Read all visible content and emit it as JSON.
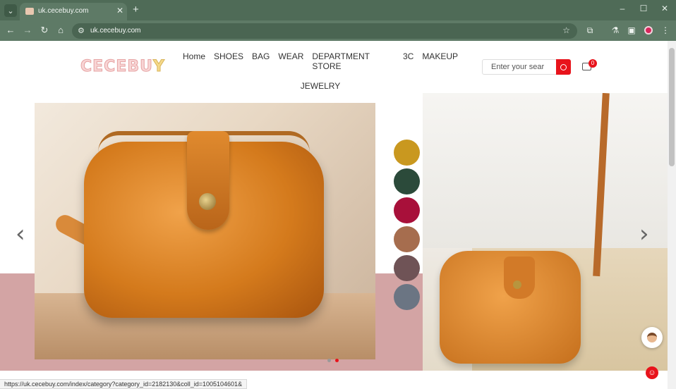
{
  "browser": {
    "tab_title": "uk.cecebuy.com",
    "url": "uk.cecebuy.com",
    "new_tab_symbol": "+",
    "close_symbol": "✕",
    "status_url": "https://uk.cecebuy.com/index/category?category_id=2182130&coll_id=1005104601&"
  },
  "site": {
    "logo_text_main": "CECEBU",
    "logo_text_accent": "Y",
    "nav": {
      "items": [
        "Home",
        "SHOES",
        "BAG",
        "WEAR",
        "DEPARTMENT STORE",
        "3C",
        "MAKEUP"
      ],
      "second_row": "JEWELRY"
    },
    "search": {
      "placeholder": "Enter your sear"
    },
    "cart": {
      "count": "0"
    }
  },
  "banner": {
    "swatch_colors": [
      "#c9981f",
      "#2b4a3a",
      "#a8103a",
      "#a66d4e",
      "#6f5356",
      "#6b7583"
    ],
    "active_slide": 2,
    "slide_count": 2,
    "prev_arrow": "‹",
    "next_arrow": "›"
  }
}
